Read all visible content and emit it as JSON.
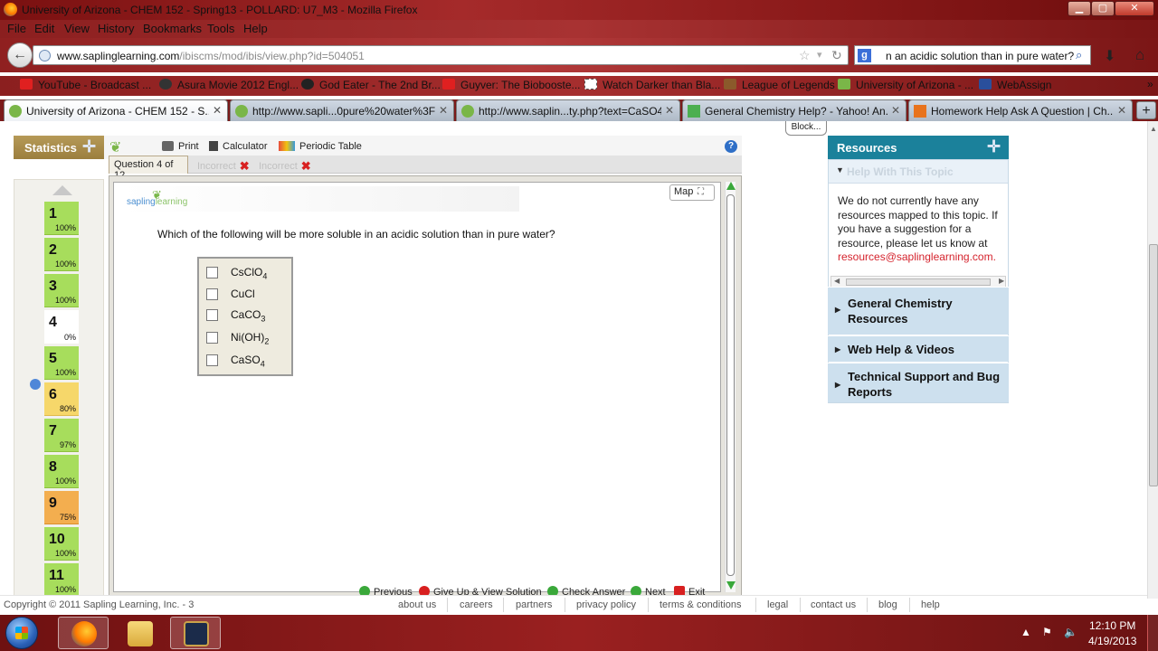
{
  "window": {
    "title": "University of Arizona - CHEM 152 - Spring13 - POLLARD: U7_M3 - Mozilla Firefox",
    "min": "▁",
    "max": "▢",
    "close": "✕"
  },
  "menu": [
    "File",
    "Edit",
    "View",
    "History",
    "Bookmarks",
    "Tools",
    "Help"
  ],
  "nav": {
    "url_host": "www.saplinglearning.com",
    "url_path": "/ibiscms/mod/ibis/view.php?id=504051",
    "search_value": "n an acidic solution than in pure water?"
  },
  "bookmarks": [
    {
      "label": "YouTube - Broadcast ...",
      "color": "#e02020"
    },
    {
      "label": "Asura Movie 2012 Engl...",
      "color": "#333333"
    },
    {
      "label": "God Eater - The 2nd Br...",
      "color": "#222222"
    },
    {
      "label": "Guyver: The Biobooste...",
      "color": "#e02020"
    },
    {
      "label": "Watch Darker than Bla...",
      "color": "#ffffff"
    },
    {
      "label": "League of Legends",
      "color": "#8b5a2b"
    },
    {
      "label": "University of Arizona - ...",
      "color": "#7ab648"
    },
    {
      "label": "WebAssign",
      "color": "#2a4f9c"
    }
  ],
  "tabs": [
    {
      "label": "University of Arizona - CHEM 152 - S...",
      "active": true,
      "color": "#7ab648"
    },
    {
      "label": "http://www.sapli...0pure%20water%3F",
      "active": false,
      "color": "#7ab648"
    },
    {
      "label": "http://www.saplin...ty.php?text=CaSO4",
      "active": false,
      "color": "#7ab648"
    },
    {
      "label": "General Chemistry Help? - Yahoo! An...",
      "active": false,
      "color": "#4caf50"
    },
    {
      "label": "Homework Help Ask A Question | Ch...",
      "active": false,
      "color": "#e8731d"
    }
  ],
  "page": {
    "blocked": "Block...",
    "stats_label": "Statistics",
    "tools": [
      "Print",
      "Calculator",
      "Periodic Table"
    ],
    "question_tab": "Question 4 of 12",
    "incorrect": [
      "Incorrect",
      "Incorrect"
    ],
    "brand": "sapling",
    "brand2": "learning",
    "map_label": "Map",
    "prompt": "Which of the following will be more soluble in an acidic solution than in pure water?",
    "answers": [
      {
        "base": "CsClO",
        "sub": "4"
      },
      {
        "base": "CuCl",
        "sub": ""
      },
      {
        "base": "CaCO",
        "sub": "3"
      },
      {
        "base": "Ni(OH)",
        "sub": "2"
      },
      {
        "base": "CaSO",
        "sub": "4"
      }
    ],
    "actions": [
      "Previous",
      "Give Up & View Solution",
      "Check Answer",
      "Next",
      "Exit"
    ]
  },
  "questions": [
    {
      "num": "1",
      "pct": "100%",
      "status": "green"
    },
    {
      "num": "2",
      "pct": "100%",
      "status": "green"
    },
    {
      "num": "3",
      "pct": "100%",
      "status": "green"
    },
    {
      "num": "4",
      "pct": "0%",
      "status": "white"
    },
    {
      "num": "5",
      "pct": "100%",
      "status": "green"
    },
    {
      "num": "6",
      "pct": "80%",
      "status": "yellow"
    },
    {
      "num": "7",
      "pct": "97%",
      "status": "green"
    },
    {
      "num": "8",
      "pct": "100%",
      "status": "green"
    },
    {
      "num": "9",
      "pct": "75%",
      "status": "orange"
    },
    {
      "num": "10",
      "pct": "100%",
      "status": "green"
    },
    {
      "num": "11",
      "pct": "100%",
      "status": "green"
    }
  ],
  "resources": {
    "header": "Resources",
    "help_topic": "Help With This Topic",
    "text": "We do not currently have any resources mapped to this topic. If you have a suggestion for a resource, please let us know at",
    "link": "resources@saplinglearning.com.",
    "sections": [
      "General Chemistry Resources",
      "Web Help & Videos",
      "Technical Support and Bug Reports"
    ]
  },
  "footer": {
    "copyright": "Copyright © 2011 Sapling Learning, Inc. - 3",
    "links": [
      "about us",
      "careers",
      "partners",
      "privacy policy",
      "terms & conditions",
      "legal",
      "contact us",
      "blog",
      "help"
    ]
  },
  "taskbar": {
    "time": "12:10 PM",
    "date": "4/19/2013"
  }
}
